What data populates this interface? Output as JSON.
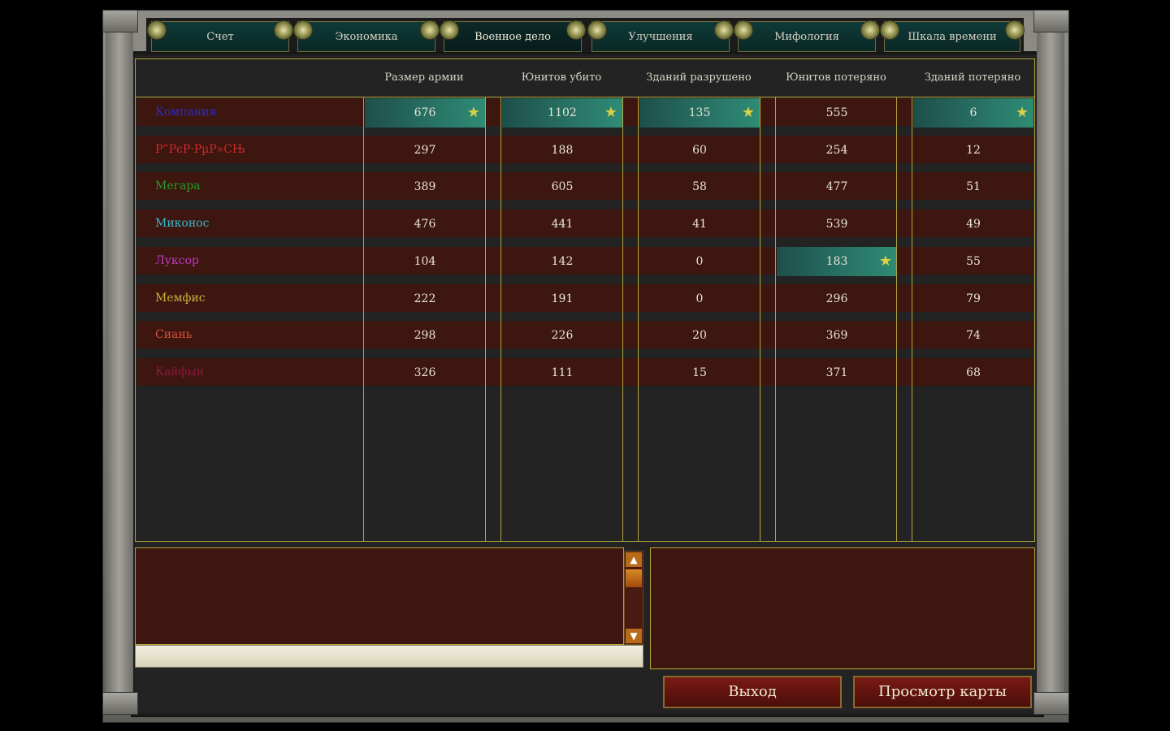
{
  "tabs": [
    {
      "label": "Счет"
    },
    {
      "label": "Экономика"
    },
    {
      "label": "Военное дело"
    },
    {
      "label": "Улучшения"
    },
    {
      "label": "Мифология"
    },
    {
      "label": "Шкала времени"
    }
  ],
  "active_tab": "Военное дело",
  "columns": [
    "Размер армии",
    "Юнитов убито",
    "Зданий разрушено",
    "Юнитов потеряно",
    "Зданий потеряно"
  ],
  "players": [
    {
      "name": "Компания",
      "color": "#2a2ad0",
      "values": [
        "676",
        "1102",
        "135",
        "555",
        "6"
      ],
      "best": [
        true,
        true,
        true,
        false,
        true
      ]
    },
    {
      "name": "Р”РєР·РµР»СЊ",
      "color": "#d02a2a",
      "values": [
        "297",
        "188",
        "60",
        "254",
        "12"
      ],
      "best": [
        false,
        false,
        false,
        false,
        false
      ]
    },
    {
      "name": "Мегара",
      "color": "#2a9a2a",
      "values": [
        "389",
        "605",
        "58",
        "477",
        "51"
      ],
      "best": [
        false,
        false,
        false,
        false,
        false
      ]
    },
    {
      "name": "Миконос",
      "color": "#3ab8c8",
      "values": [
        "476",
        "441",
        "41",
        "539",
        "49"
      ],
      "best": [
        false,
        false,
        false,
        false,
        false
      ]
    },
    {
      "name": "Луксор",
      "color": "#c03ac8",
      "values": [
        "104",
        "142",
        "0",
        "183",
        "55"
      ],
      "best": [
        false,
        false,
        false,
        true,
        false
      ]
    },
    {
      "name": "Мемфис",
      "color": "#c8b43a",
      "values": [
        "222",
        "191",
        "0",
        "296",
        "79"
      ],
      "best": [
        false,
        false,
        false,
        false,
        false
      ]
    },
    {
      "name": "Сиань",
      "color": "#d8503a",
      "values": [
        "298",
        "226",
        "20",
        "369",
        "74"
      ],
      "best": [
        false,
        false,
        false,
        false,
        false
      ]
    },
    {
      "name": "Кайфын",
      "color": "#8a1a3a",
      "values": [
        "326",
        "111",
        "15",
        "371",
        "68"
      ],
      "best": [
        false,
        false,
        false,
        false,
        false
      ]
    }
  ],
  "star_icon": "★",
  "buttons": {
    "exit": "Выход",
    "view_map": "Просмотр карты"
  },
  "scroll": {
    "up": "▲",
    "down": "▼"
  },
  "colors": {
    "highlight": "#2a7a6a",
    "row_bg": "#3d1610",
    "border_gold": "#b6a53a",
    "star": "#d9d047"
  }
}
